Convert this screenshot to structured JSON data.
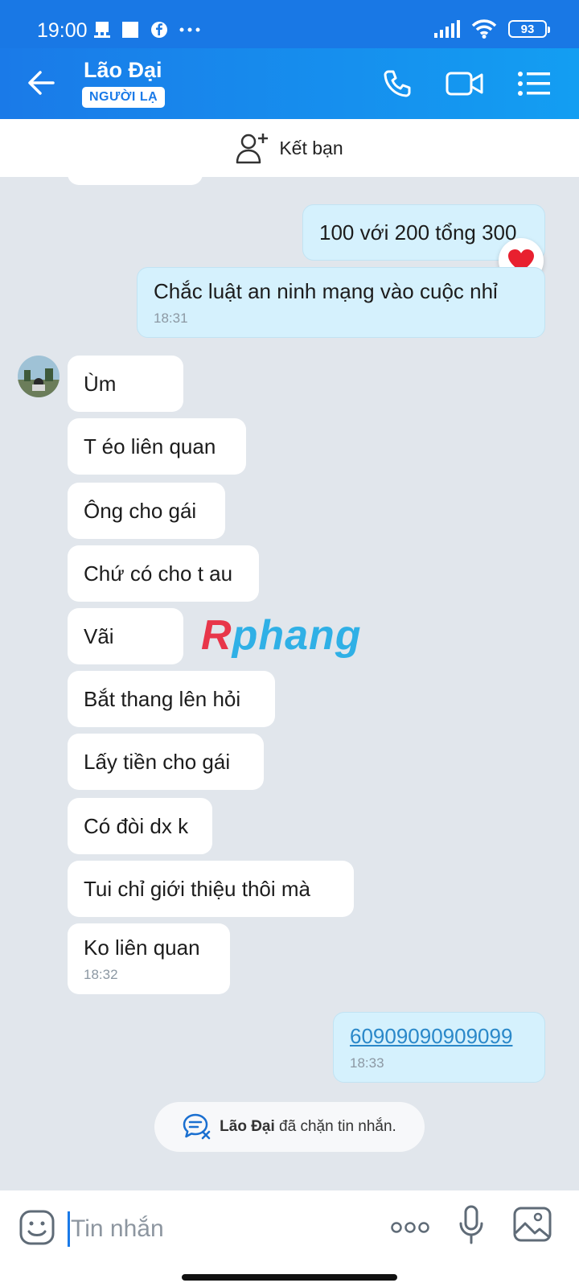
{
  "status_bar": {
    "time": "19:00",
    "battery": "93",
    "left_icons": [
      "notification-icon",
      "square-app-icon",
      "facebook-icon",
      "more-dots-icon"
    ],
    "right_icons": [
      "signal-icon",
      "wifi-icon",
      "battery-icon"
    ]
  },
  "header": {
    "name": "Lão Đại",
    "badge": "NGƯỜI LẠ"
  },
  "add_friend": {
    "label": "Kết bạn"
  },
  "messages": {
    "out_1": {
      "text": "100 với 200 tổng 300"
    },
    "out_2": {
      "text": "Chắc luật an ninh mạng vào cuộc nhỉ",
      "time": "18:31"
    },
    "in": [
      {
        "text": "Ùm"
      },
      {
        "text": "T éo liên quan"
      },
      {
        "text": "Ông cho gái"
      },
      {
        "text": "Chứ có cho t au"
      },
      {
        "text": "Vãi"
      },
      {
        "text": "Bắt thang lên hỏi"
      },
      {
        "text": "Lấy tiền cho gái"
      },
      {
        "text": "Có đòi dx k"
      },
      {
        "text": "Tui chỉ giới thiệu thôi mà"
      },
      {
        "text": "Ko liên quan",
        "time": "18:32"
      }
    ],
    "out_3": {
      "text": "60909090909099",
      "time": "18:33"
    }
  },
  "watermark": {
    "first": "R",
    "rest": "phang"
  },
  "blocked": {
    "name": "Lão Đại",
    "text": "đã chặn tin nhắn."
  },
  "input": {
    "placeholder": "Tin nhắn"
  },
  "colors": {
    "header": "#1a7ae8",
    "outgoing": "#d5f1fd",
    "incoming": "#ffffff",
    "chat_bg": "#e1e6ec"
  }
}
